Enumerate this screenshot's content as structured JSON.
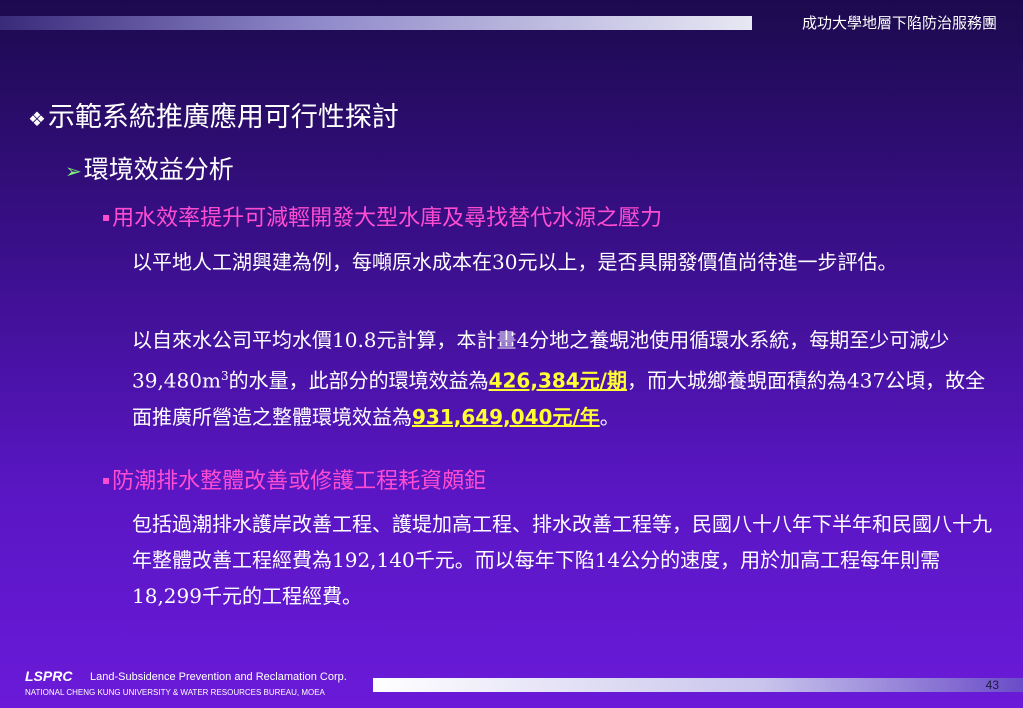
{
  "header": {
    "org": "成功大學地層下陷防治服務團"
  },
  "h1": {
    "bullet": "❖",
    "text": "示範系統推廣應用可行性探討"
  },
  "h2": {
    "bullet": "➢",
    "text": "環境效益分析"
  },
  "section1": {
    "bullet": "▪",
    "title": "用水效率提升可減輕開發大型水庫及尋找替代水源之壓力",
    "para1": "以平地人工湖興建為例，每噸原水成本在30元以上，是否具開發價值尚待進一步評估。",
    "para2_a": "以自來水公司平均水價10.8元計算，本計畫4分地之養蜆池使用循環水系統，每期至少可減少39,480m",
    "para2_sup": "3",
    "para2_b": "的水量，此部分的環境效益為",
    "para2_hl1": "426,384元/期",
    "para2_c": "，而大城鄉養蜆面積約為437公頃，故全面推廣所營造之整體環境效益為",
    "para2_hl2": "931,649,040元/年",
    "para2_d": "。"
  },
  "section2": {
    "bullet": "▪",
    "title": "防潮排水整體改善或修護工程耗資頗鉅",
    "para": "包括過潮排水護岸改善工程、護堤加高工程、排水改善工程等，民國八十八年下半年和民國八十九年整體改善工程經費為192,140千元。而以每年下陷14公分的速度，用於加高工程每年則需18,299千元的工程經費。"
  },
  "footer": {
    "logo": "LSPRC",
    "corp": "Land-Subsidence Prevention and Reclamation Corp.",
    "univ": "NATIONAL CHENG KUNG UNIVERSITY & WATER RESOURCES BUREAU, MOEA",
    "page": "43"
  }
}
